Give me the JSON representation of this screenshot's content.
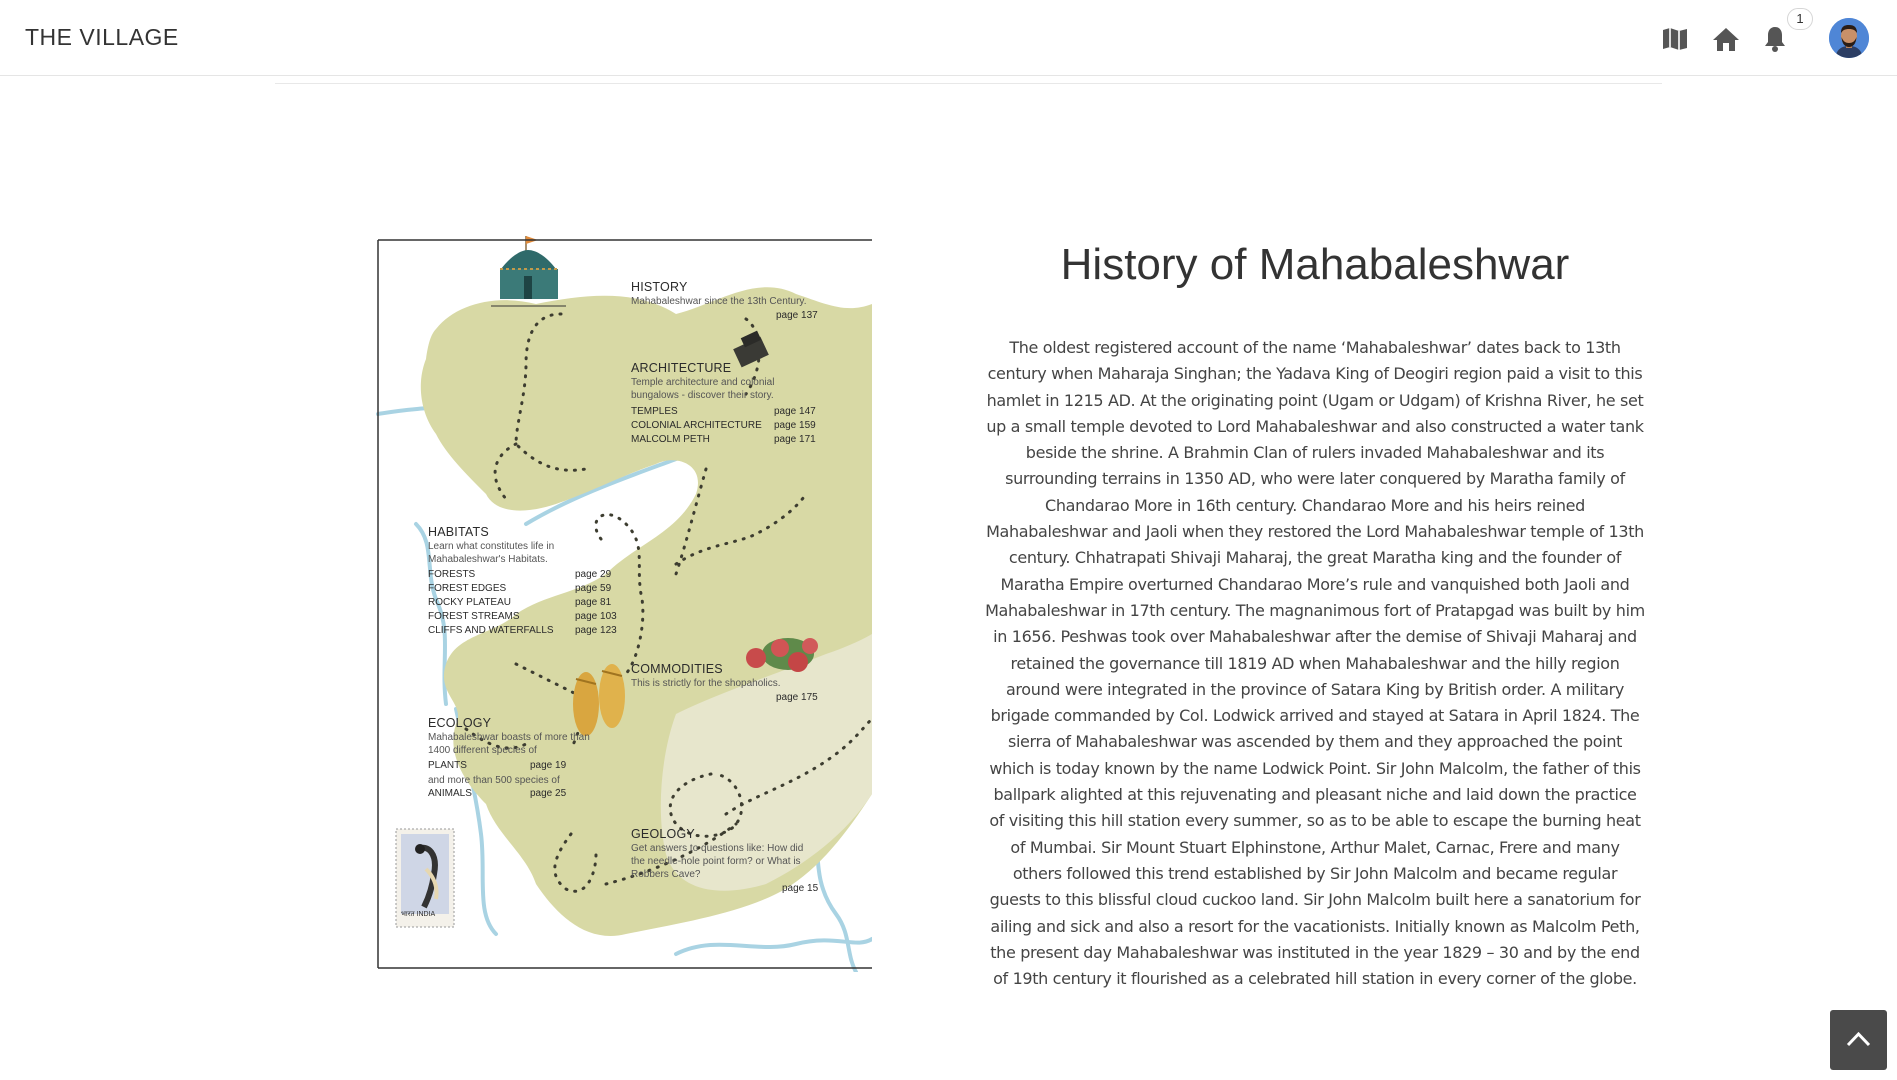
{
  "header": {
    "brand": "THE VILLAGE",
    "notification_count": "1",
    "icons": [
      "map-icon",
      "home-icon",
      "bell-icon"
    ]
  },
  "map": {
    "history": {
      "title": "HISTORY",
      "desc": "Mahabaleshwar since the 13th Century.",
      "page": "page 137"
    },
    "architecture": {
      "title": "ARCHITECTURE",
      "desc": "Temple architecture and colonial bungalows - discover their story.",
      "rows": [
        {
          "label": "TEMPLES",
          "page": "page 147"
        },
        {
          "label": "COLONIAL ARCHITECTURE",
          "page": "page 159"
        },
        {
          "label": "MALCOLM PETH",
          "page": "page 171"
        }
      ]
    },
    "habitats": {
      "title": "HABITATS",
      "desc": "Learn what constitutes life in Mahabaleshwar's Habitats.",
      "rows": [
        {
          "label": "FORESTS",
          "page": "page  29"
        },
        {
          "label": "FOREST EDGES",
          "page": "page  59"
        },
        {
          "label": "ROCKY PLATEAU",
          "page": "page  81"
        },
        {
          "label": "FOREST STREAMS",
          "page": "page 103"
        },
        {
          "label": "CLIFFS AND WATERFALLS",
          "page": "page 123"
        }
      ]
    },
    "commodities": {
      "title": "COMMODITIES",
      "desc": "This is strictly for the shopaholics.",
      "page": "page 175"
    },
    "ecology": {
      "title": "ECOLOGY",
      "desc1": "Mahabaleshwar boasts of more than 1400 different species of",
      "row1": {
        "label": "PLANTS",
        "page": "page 19"
      },
      "desc2": "and more than 500 species of",
      "row2": {
        "label": "ANIMALS",
        "page": "page 25"
      }
    },
    "geology": {
      "title": "GEOLOGY",
      "desc": "Get answers to questions like: How did the needle-hole point form? or What is Robbers Cave?",
      "page": "page 15"
    },
    "stamp_text": "भारत INDIA"
  },
  "article": {
    "title": "History of Mahabaleshwar",
    "body": "The oldest registered account of the name ‘Mahabaleshwar’ dates back to 13th century when Maharaja Singhan; the Yadava King of Deogiri region paid a visit to this hamlet in 1215 AD. At the originating point (Ugam or Udgam) of Krishna River, he set up a small temple devoted to Lord Mahabaleshwar and also constructed a water tank beside the shrine. A Brahmin Clan of rulers invaded Mahabaleshwar and its surrounding terrains in 1350 AD, who were later conquered by Maratha family of Chandarao More in 16th century. Chandarao More and his heirs reined Mahabaleshwar and Jaoli when they restored the Lord Mahabaleshwar temple of 13th century. Chhatrapati Shivaji Maharaj, the great Maratha king and the founder of Maratha Empire overturned Chandarao More’s rule and vanquished both Jaoli and Mahabaleshwar in 17th century. The magnanimous fort of Pratapgad was built by him in 1656. Peshwas took over Mahabaleshwar after the demise of Shivaji Maharaj and retained the governance till 1819 AD when Mahabaleshwar and the hilly region around were integrated in the province of Satara King by British order. A military brigade commanded by Col. Lodwick arrived and stayed at Satara in April 1824. The sierra of Mahabaleshwar was ascended by them and they approached the point which is today known by the name Lodwick Point. Sir John Malcolm, the father of this ballpark alighted at this rejuvenating and pleasant niche and laid down the practice of visiting this hill station every summer, so as to be able to escape the burning heat of Mumbai. Sir Mount Stuart Elphinstone, Arthur Malet, Carnac, Frere and many others followed this trend established by Sir John Malcolm and became regular guests to this blissful cloud cuckoo land. Sir John Malcolm built here a sanatorium for ailing and sick and also a resort for the vacationists. Initially known as Malcolm Peth, the present day Mahabaleshwar was instituted in the year 1829 – 30 and by the end of 19th century it flourished as a celebrated hill station in every corner of the globe."
  },
  "colors": {
    "land": "#dcdcaa",
    "water": "#a9d3e3",
    "accent": "#3a7bd5",
    "scroll_button": "#4a4a4a"
  }
}
